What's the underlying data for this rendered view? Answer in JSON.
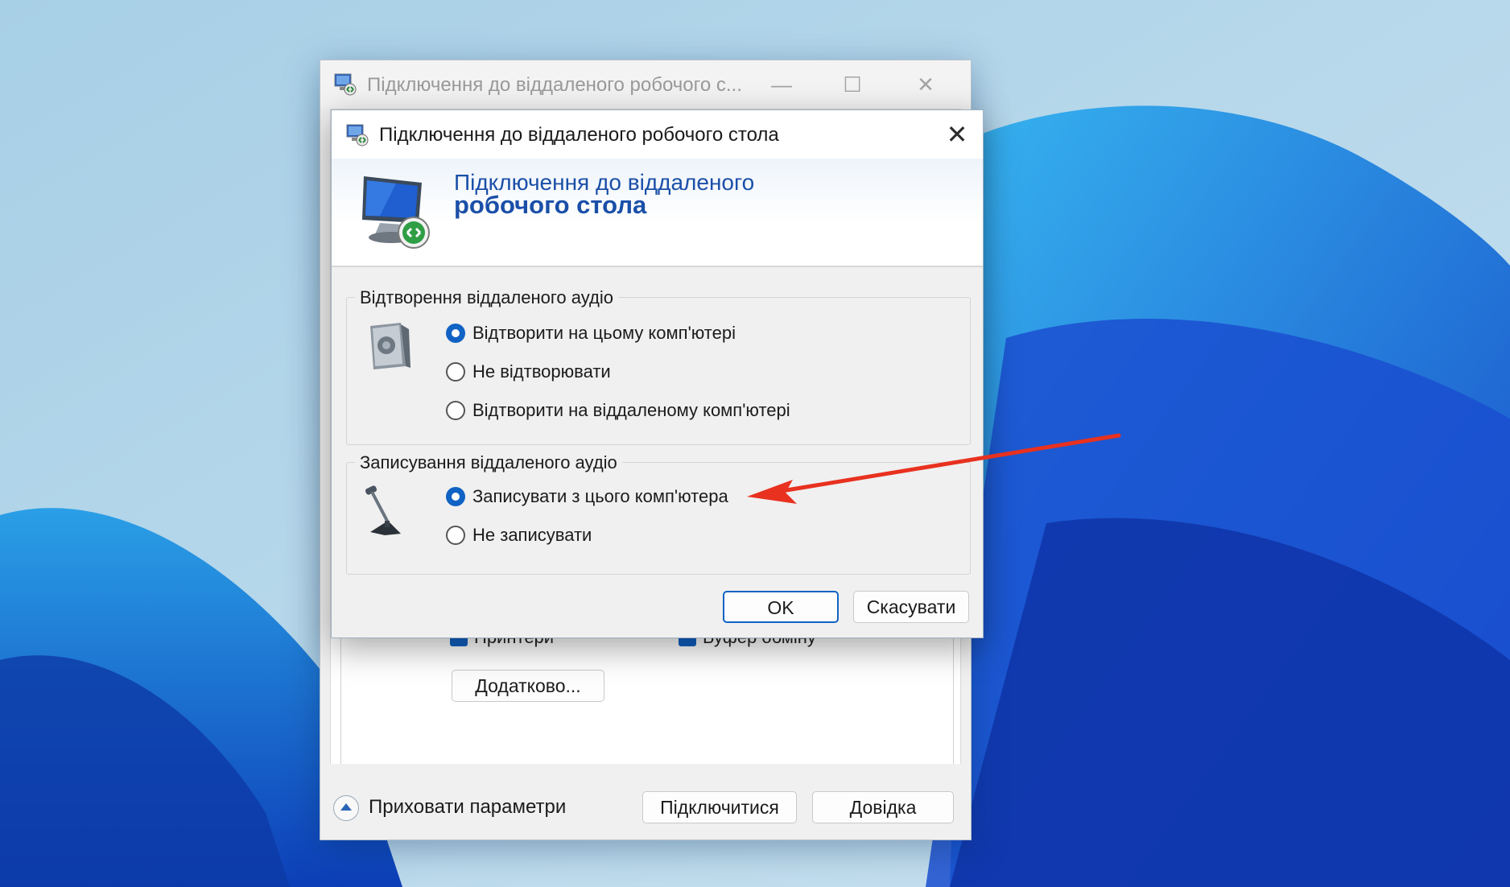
{
  "back_window": {
    "title": "Підключення до віддаленого робочого с...",
    "minimize_glyph": "—",
    "maximize_glyph": "☐",
    "close_glyph": "✕",
    "checkbox_printers_label": "Принтери",
    "checkbox_clipboard_label": "Буфер обміну",
    "advanced_button": "Додатково...",
    "hide_options_label": "Приховати параметри",
    "connect_button": "Підключитися",
    "help_button": "Довідка"
  },
  "dialog": {
    "title": "Підключення до віддаленого робочого стола",
    "close_glyph": "✕",
    "banner": {
      "line1": "Підключення до віддаленого",
      "line2": "робочого стола"
    },
    "playback_group": {
      "title": "Відтворення віддаленого аудіо",
      "options": [
        {
          "label": "Відтворити на цьому комп'ютері",
          "selected": true
        },
        {
          "label": "Не відтворювати",
          "selected": false
        },
        {
          "label": "Відтворити на віддаленому комп'ютері",
          "selected": false
        }
      ]
    },
    "recording_group": {
      "title": "Записування віддаленого аудіо",
      "options": [
        {
          "label": "Записувати з цього комп'ютера",
          "selected": true
        },
        {
          "label": "Не записувати",
          "selected": false
        }
      ]
    },
    "ok_button": "OK",
    "cancel_button": "Скасувати"
  },
  "colors": {
    "accent": "#1062c4",
    "banner_text": "#1a4fa8",
    "annotation_arrow": "#e8311f"
  }
}
